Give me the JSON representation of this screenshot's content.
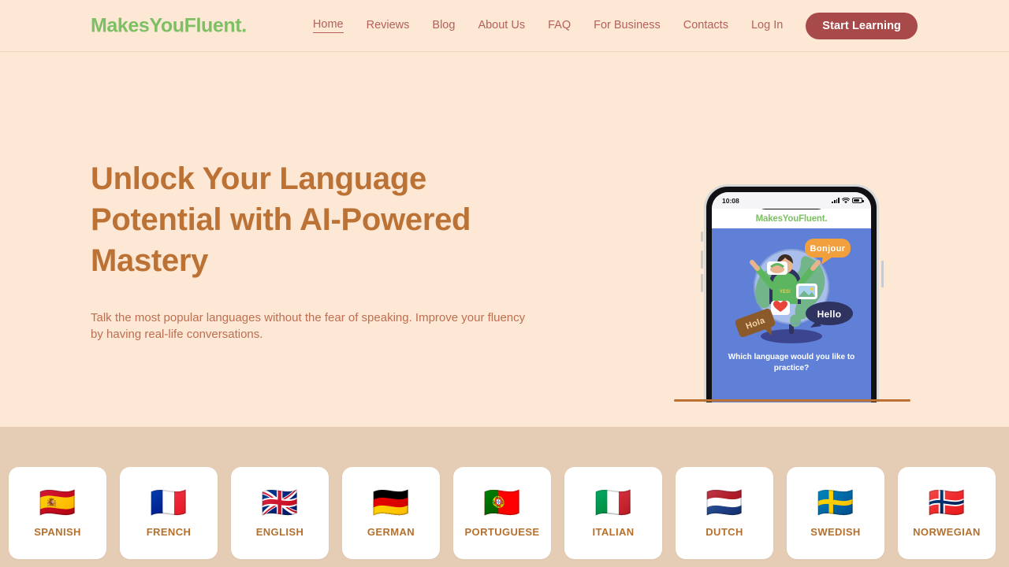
{
  "header": {
    "brand": "MakesYouFluent.",
    "nav_items": [
      {
        "label": "Home",
        "active": true
      },
      {
        "label": "Reviews",
        "active": false
      },
      {
        "label": "Blog",
        "active": false
      },
      {
        "label": "About Us",
        "active": false
      },
      {
        "label": "FAQ",
        "active": false
      },
      {
        "label": "For Business",
        "active": false
      },
      {
        "label": "Contacts",
        "active": false
      },
      {
        "label": "Log In",
        "active": false
      }
    ],
    "cta_label": "Start Learning",
    "cta_color": "#A94A4A",
    "brand_color": "#7DC063",
    "nav_color": "#B4615C"
  },
  "hero": {
    "title": "Unlock Your Language Potential with AI-Powered Mastery",
    "subtitle": "Talk the most popular languages without the fear of speaking. Improve your fluency by having real-life conversations.",
    "title_color": "#BC7235",
    "subtitle_color": "#BE6E51",
    "background": "#FCE8D5"
  },
  "phone": {
    "status_time": "10:08",
    "status_icons": [
      "signal-icon",
      "wifi-icon",
      "battery-icon"
    ],
    "app_logo": "MakesYouFluent.",
    "screen_background": "#6080D8",
    "question": "Which language would you like to practice?",
    "illustration": {
      "name": "globe-language-illustration",
      "bubbles": [
        {
          "text": "Bonjour",
          "color": "#F2A03D"
        },
        {
          "text": "Hello",
          "color": "#2E3360"
        },
        {
          "text": "Hola",
          "color": "#8A5A2B"
        }
      ],
      "cards": [
        "food-card",
        "photo-card",
        "heart-card"
      ]
    }
  },
  "languages": {
    "background": "#E5CDB5",
    "label_color": "#B5702D",
    "items": [
      {
        "label": "SPANISH",
        "flag": "🇪🇸"
      },
      {
        "label": "FRENCH",
        "flag": "🇫🇷"
      },
      {
        "label": "ENGLISH",
        "flag": "🇬🇧"
      },
      {
        "label": "GERMAN",
        "flag": "🇩🇪"
      },
      {
        "label": "PORTUGUESE",
        "flag": "🇵🇹"
      },
      {
        "label": "ITALIAN",
        "flag": "🇮🇹"
      },
      {
        "label": "DUTCH",
        "flag": "🇳🇱"
      },
      {
        "label": "SWEDISH",
        "flag": "🇸🇪"
      },
      {
        "label": "NORWEGIAN",
        "flag": "🇳🇴"
      }
    ]
  }
}
